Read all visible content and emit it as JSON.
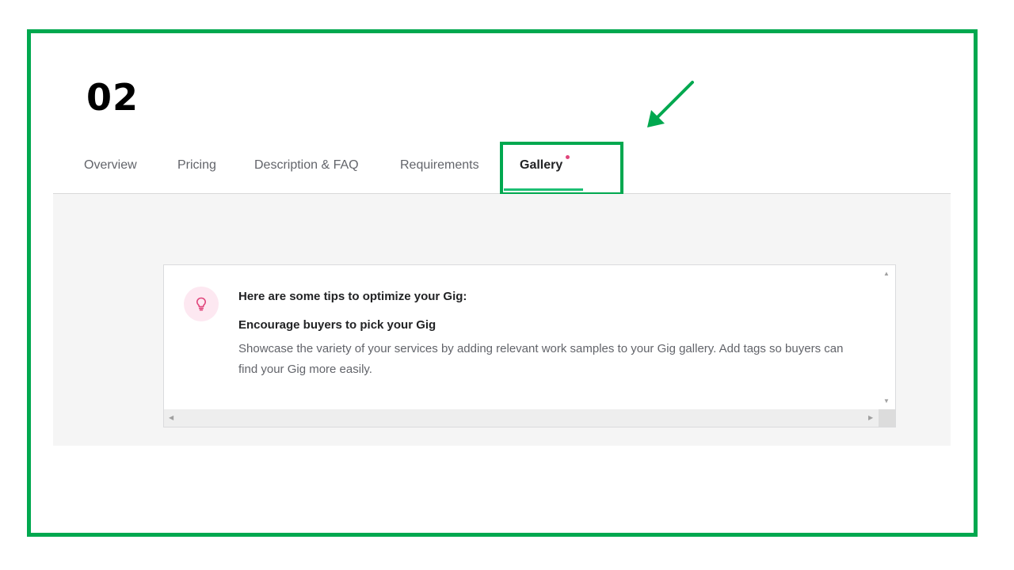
{
  "step": {
    "number": "02"
  },
  "tabs": [
    {
      "label": "Overview"
    },
    {
      "label": "Pricing"
    },
    {
      "label": "Description & FAQ"
    },
    {
      "label": "Requirements"
    },
    {
      "label": "Gallery",
      "active": true,
      "required": true
    }
  ],
  "tips": {
    "heading": "Here are some tips to optimize your Gig:",
    "subheading": "Encourage buyers to pick your Gig",
    "body": "Showcase the variety of your services by adding relevant work samples to your Gig gallery. Add tags so buyers can find your Gig more easily.",
    "icon": "lightbulb-icon"
  },
  "colors": {
    "annotation_green": "#00a84f",
    "active_underline": "#1dbf73",
    "required_dot": "#e0457b",
    "bulb_pink": "#e0457b"
  },
  "icons": {
    "arrow": "annotation-arrow-icon",
    "scroll_up": "scroll-up-icon",
    "scroll_down": "scroll-down-icon",
    "scroll_left": "scroll-left-icon",
    "scroll_right": "scroll-right-icon"
  }
}
